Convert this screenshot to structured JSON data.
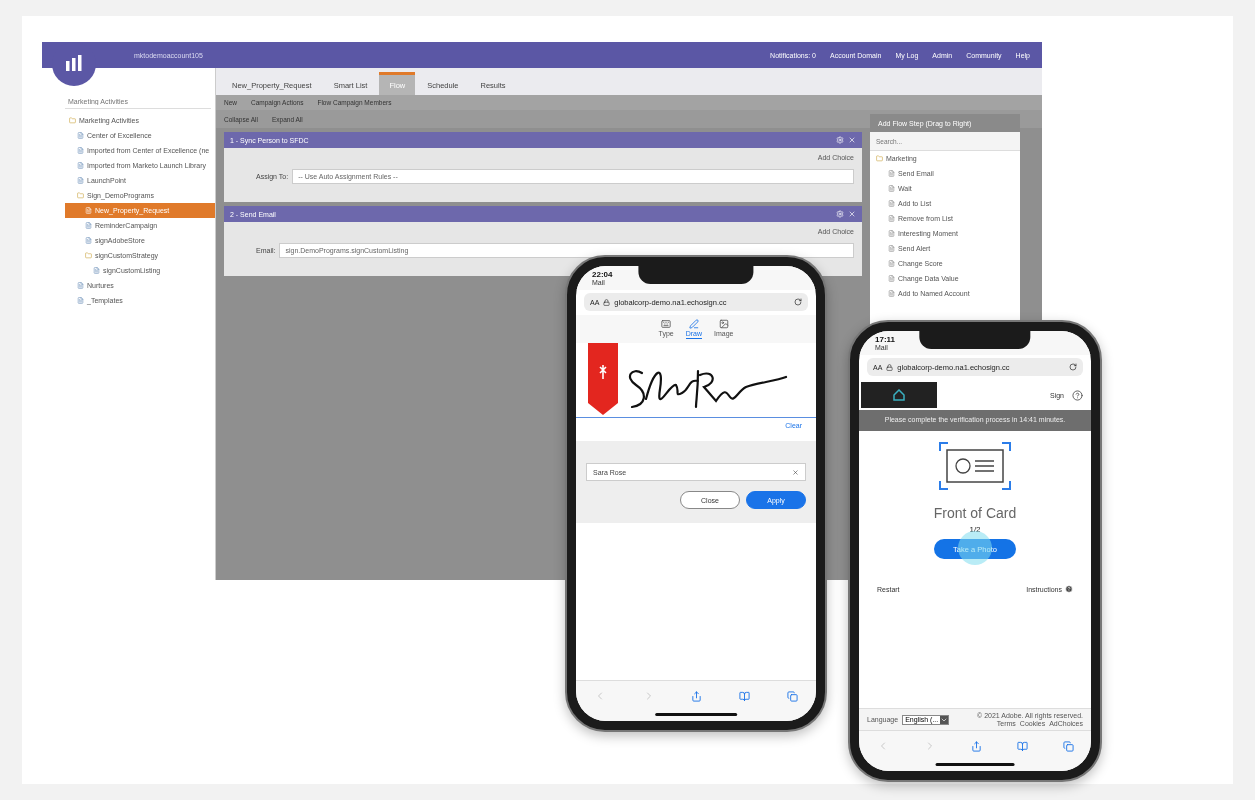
{
  "desktop": {
    "account": "mktodemoaccount105",
    "top_links": [
      "Notifications: 0",
      "Account Domain",
      "My Log",
      "Admin",
      "Community",
      "Help"
    ],
    "tabs": [
      {
        "label": "New_Property_Request",
        "selected": false
      },
      {
        "label": "Smart List",
        "selected": false
      },
      {
        "label": "Flow",
        "selected": true
      },
      {
        "label": "Schedule",
        "selected": false
      },
      {
        "label": "Results",
        "selected": false
      }
    ],
    "toolbar": [
      "New",
      "Campaign Actions",
      "Flow Campaign Members"
    ],
    "toolbar_2": [
      "Collapse All",
      "Expand All"
    ],
    "sidebar": {
      "search": {
        "placeholder": "Marketing Activities"
      },
      "tree": [
        {
          "label": "Marketing Activities",
          "selected": false,
          "children": [
            {
              "label": "Center of Excellence",
              "selected": false
            },
            {
              "label": "Imported from Center of Excellence (ne",
              "selected": false
            },
            {
              "label": "Imported from Marketo Launch Library",
              "selected": false
            },
            {
              "label": "LaunchPoint",
              "selected": false
            },
            {
              "label": "Sign_DemoPrograms",
              "selected": false,
              "children": [
                {
                  "label": "New_Property_Request",
                  "selected": true
                },
                {
                  "label": "ReminderCampaign",
                  "selected": false
                },
                {
                  "label": "signAdobeStore",
                  "selected": false
                },
                {
                  "label": "signCustomStrategy",
                  "selected": false,
                  "children": [
                    {
                      "label": "signCustomListing",
                      "selected": false
                    }
                  ]
                }
              ]
            },
            {
              "label": "Nurtures",
              "selected": false
            },
            {
              "label": "_Templates",
              "selected": false
            }
          ]
        }
      ]
    },
    "steps": [
      {
        "title": "1 - Sync Person to SFDC",
        "field_label": "Assign To:",
        "value": "-- Use Auto Assignment Rules --",
        "add_choice": "Add Choice"
      },
      {
        "title": "2 - Send Email",
        "field_label": "Email:",
        "value": "sign.DemoPrograms.signCustomListing",
        "add_choice": "Add Choice"
      }
    ],
    "flow_panel": {
      "title": "Add Flow Step (Drag to Right)",
      "search": {
        "placeholder": "Search..."
      },
      "group": "Marketing",
      "items": [
        "Send Email",
        "Wait",
        "Add to List",
        "Remove from List",
        "Interesting Moment",
        "Send Alert",
        "Change Score",
        "Change Data Value",
        "Add to Named Account"
      ]
    }
  },
  "phone_sign": {
    "time": "22:04",
    "back_app": "Mail",
    "text_size": "AA",
    "url": "globalcorp-demo.na1.echosign.cc",
    "modes": [
      {
        "label": "Type",
        "selected": false
      },
      {
        "label": "Draw",
        "selected": true
      },
      {
        "label": "Image",
        "selected": false
      }
    ],
    "clear": "Clear",
    "name_field": "Sara Rose",
    "buttons": [
      {
        "label": "Close",
        "kind": "secondary"
      },
      {
        "label": "Apply",
        "kind": "primary"
      }
    ]
  },
  "phone_verify": {
    "time": "17:11",
    "back_app": "Mail",
    "text_size": "AA",
    "url": "globalcorp-demo.na1.echosign.cc",
    "sign": "Sign",
    "banner": "Please complete the verification process in 14:41 minutes.",
    "card_title": "Front of Card",
    "step": "1/2",
    "action": "Take a Photo",
    "restart": "Restart",
    "instructions": "Instructions",
    "language_label": "Language",
    "language": "English (...",
    "copyright": "© 2021 Adobe. All rights reserved.",
    "footer_links": [
      "Terms",
      "Cookies",
      "AdChoices"
    ]
  }
}
